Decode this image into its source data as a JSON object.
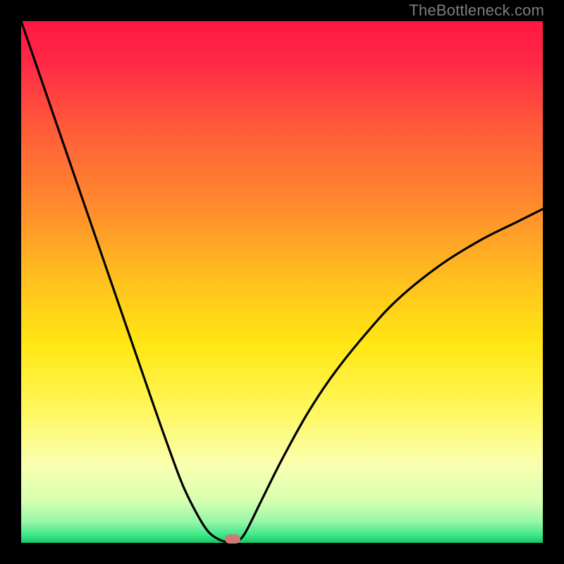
{
  "watermark": "TheBottleneck.com",
  "chart_data": {
    "type": "line",
    "title": "",
    "xlabel": "",
    "ylabel": "",
    "xlim": [
      0,
      100
    ],
    "ylim": [
      0,
      100
    ],
    "gradient_stops": [
      {
        "offset": 0.0,
        "color": "#ff1744"
      },
      {
        "offset": 0.08,
        "color": "#ff2a47"
      },
      {
        "offset": 0.2,
        "color": "#ff5a3a"
      },
      {
        "offset": 0.35,
        "color": "#ff8a2e"
      },
      {
        "offset": 0.5,
        "color": "#ffc21e"
      },
      {
        "offset": 0.62,
        "color": "#ffe714"
      },
      {
        "offset": 0.74,
        "color": "#fff75a"
      },
      {
        "offset": 0.85,
        "color": "#fbffb0"
      },
      {
        "offset": 0.92,
        "color": "#d7ffb0"
      },
      {
        "offset": 0.96,
        "color": "#95f7a8"
      },
      {
        "offset": 0.985,
        "color": "#3fe887"
      },
      {
        "offset": 1.0,
        "color": "#18c76a"
      }
    ],
    "series": [
      {
        "name": "bottleneck-curve",
        "x": [
          0,
          5,
          10,
          15,
          20,
          25,
          28,
          31,
          34,
          36,
          38,
          39.5,
          40.5,
          41.5,
          43,
          46,
          50,
          55,
          60,
          66,
          72,
          80,
          88,
          95,
          100
        ],
        "y": [
          100,
          85.5,
          71,
          56.5,
          42,
          27.5,
          19,
          11,
          5,
          2,
          0.6,
          0.15,
          0.1,
          0.3,
          2,
          8,
          16,
          25,
          32.5,
          40,
          46.5,
          53,
          58,
          61.5,
          64
        ]
      }
    ],
    "marker": {
      "x": 40.5,
      "y": 0.3,
      "color": "#cf7a77"
    }
  }
}
